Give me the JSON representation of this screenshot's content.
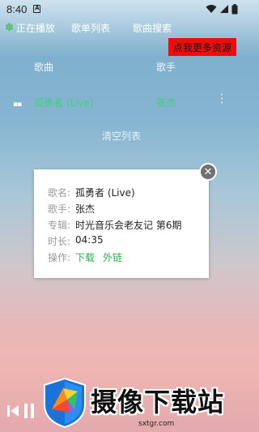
{
  "status_bar": {
    "time": "8:40",
    "notification_icon": "A"
  },
  "tabs": {
    "now_playing": "正在播放",
    "playlist": "歌单列表",
    "search": "歌曲搜索"
  },
  "promo_button": "点我更多资源",
  "list": {
    "header_song": "歌曲",
    "header_singer": "歌手",
    "rows": [
      {
        "song": "孤勇者 (Live)",
        "singer": "张杰"
      }
    ],
    "clear_label": "清空列表"
  },
  "song_dialog": {
    "title_label": "歌名:",
    "title_value": "孤勇者 (Live)",
    "singer_label": "歌手:",
    "singer_value": "张杰",
    "album_label": "专辑:",
    "album_value": "时光音乐会老友记 第6期",
    "duration_label": "时长:",
    "duration_value": "04:35",
    "actions_label": "操作:",
    "download_label": "下载",
    "link_label": "外链"
  },
  "watermark": {
    "title": "摄像下载站",
    "url": "sxtgr.com"
  },
  "colors": {
    "accent": "#3fd07a",
    "promo_bg": "#ee0d0d"
  }
}
